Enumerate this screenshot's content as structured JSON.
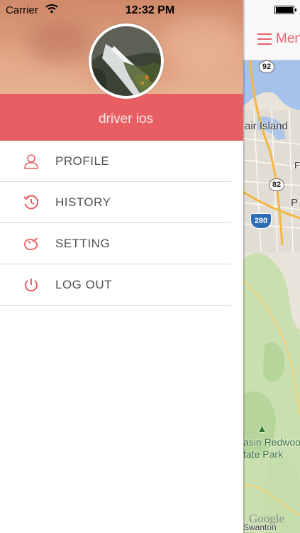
{
  "status_bar": {
    "carrier": "Carrier",
    "time": "12:32 PM"
  },
  "drawer": {
    "username": "driver ios",
    "menu": [
      {
        "label": "PROFILE",
        "icon": "person-icon"
      },
      {
        "label": "HISTORY",
        "icon": "history-clock-icon"
      },
      {
        "label": "SETTING",
        "icon": "setting-icon"
      },
      {
        "label": "LOG OUT",
        "icon": "power-icon"
      }
    ]
  },
  "map_panel": {
    "menu_label": "Menu",
    "labels": {
      "island": "air Island",
      "park_line1": "asin Redwood",
      "park_line2": "tate Park",
      "place_p": "P",
      "place_f": "F",
      "swanton": "Swanton",
      "google": "Google"
    },
    "shields": {
      "r92": "92",
      "r82": "82",
      "i280": "280"
    }
  },
  "colors": {
    "accent": "#e85f63",
    "menu_text": "#505050",
    "map_water": "#a5c2ea"
  }
}
